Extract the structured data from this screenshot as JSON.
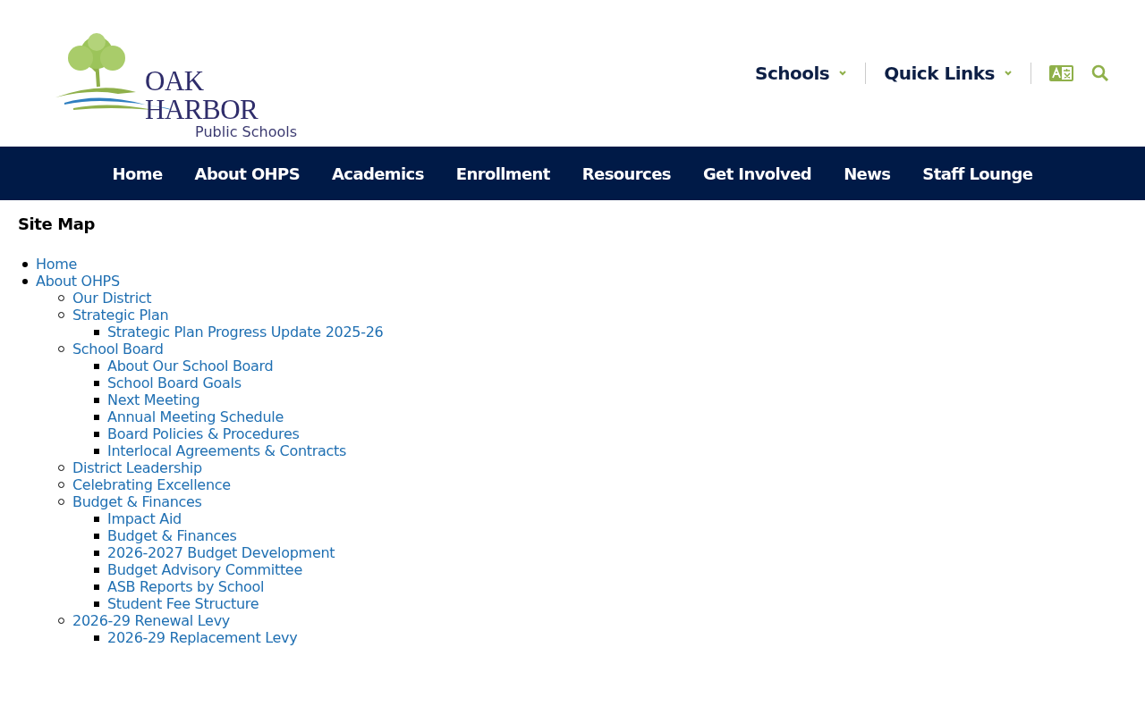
{
  "header": {
    "logo": {
      "name": "OAK HARBOR",
      "subtitle": "Public Schools"
    },
    "links": [
      {
        "label": "Schools"
      },
      {
        "label": "Quick Links"
      }
    ]
  },
  "nav": [
    {
      "label": "Home"
    },
    {
      "label": "About OHPS"
    },
    {
      "label": "Academics"
    },
    {
      "label": "Enrollment"
    },
    {
      "label": "Resources"
    },
    {
      "label": "Get Involved"
    },
    {
      "label": "News"
    },
    {
      "label": "Staff Lounge"
    }
  ],
  "sitemap": {
    "title": "Site Map",
    "items": [
      {
        "label": "Home"
      },
      {
        "label": "About OHPS",
        "children": [
          {
            "label": "Our District"
          },
          {
            "label": "Strategic Plan",
            "children": [
              {
                "label": "Strategic Plan Progress Update 2025-26"
              }
            ]
          },
          {
            "label": "School Board",
            "children": [
              {
                "label": "About Our School Board"
              },
              {
                "label": "School Board Goals"
              },
              {
                "label": "Next Meeting"
              },
              {
                "label": "Annual Meeting Schedule"
              },
              {
                "label": "Board Policies & Procedures"
              },
              {
                "label": "Interlocal Agreements & Contracts"
              }
            ]
          },
          {
            "label": "District Leadership"
          },
          {
            "label": "Celebrating Excellence"
          },
          {
            "label": "Budget & Finances",
            "children": [
              {
                "label": "Impact Aid"
              },
              {
                "label": "Budget & Finances"
              },
              {
                "label": "2026-2027 Budget Development"
              },
              {
                "label": "Budget Advisory Committee"
              },
              {
                "label": "ASB Reports by School"
              },
              {
                "label": "Student Fee Structure"
              }
            ]
          },
          {
            "label": "2026-29 Renewal Levy",
            "children": [
              {
                "label": "2026-29 Replacement Levy"
              }
            ]
          }
        ]
      }
    ]
  }
}
